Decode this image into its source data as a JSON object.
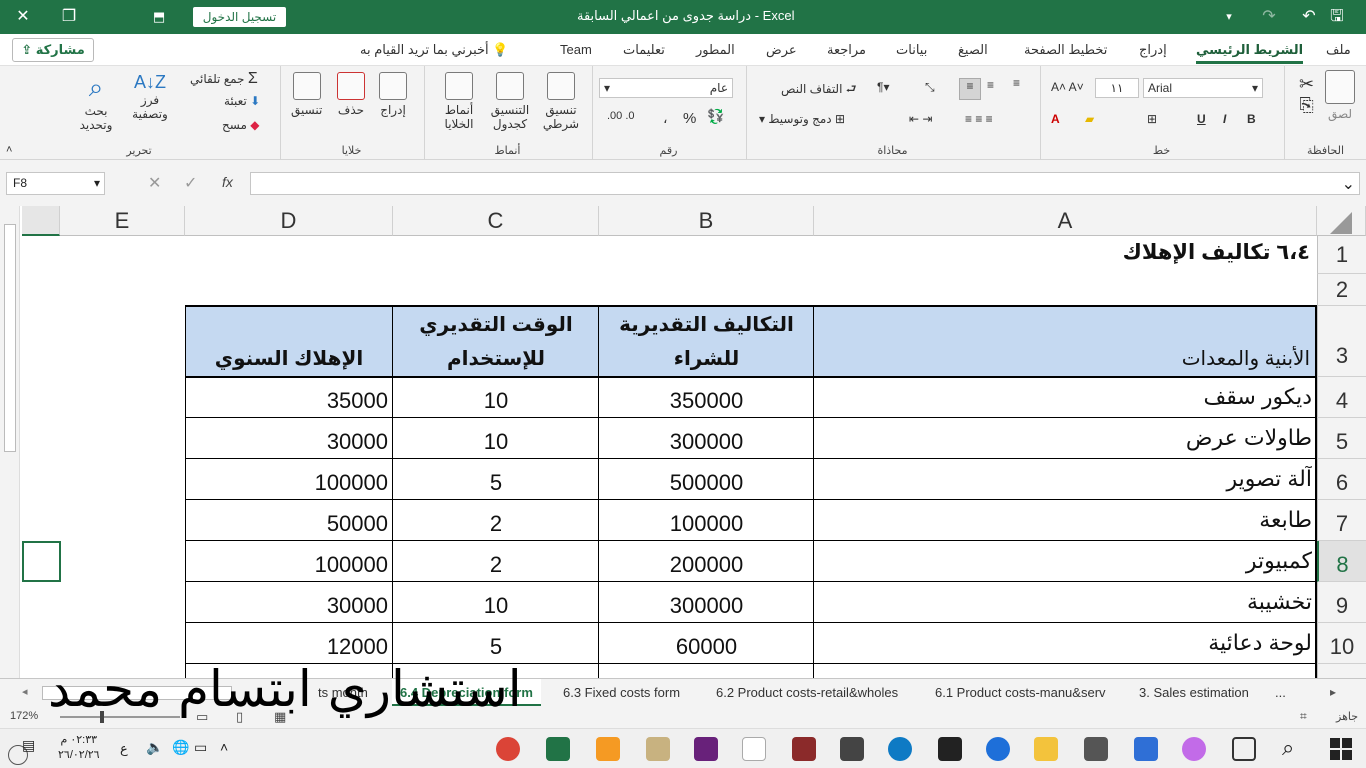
{
  "window": {
    "title": "دراسة جدوى من اعمالي السابقة  -  Excel",
    "sign_in": "تسجيل الدخول"
  },
  "ribbon_tabs": [
    "ملف",
    "الشريط الرئيسي",
    "إدراج",
    "تخطيط الصفحة",
    "الصيغ",
    "بيانات",
    "مراجعة",
    "عرض",
    "المطور",
    "تعليمات",
    "Team"
  ],
  "active_tab": "الشريط الرئيسي",
  "tell_me": "أخبرني بما تريد القيام به",
  "share": "مشاركة",
  "ribbon": {
    "clipboard": {
      "label": "الحافظة",
      "paste": "لصق"
    },
    "font": {
      "label": "خط",
      "name": "Arial",
      "size": "١١",
      "bold": "B",
      "italic": "I",
      "underline": "U"
    },
    "alignment": {
      "label": "محاذاة",
      "wrap": "التفاف النص",
      "merge": "دمج وتوسيط"
    },
    "number": {
      "label": "رقم",
      "format": "عام",
      "percent": "%",
      "comma": "،"
    },
    "styles": {
      "label": "أنماط",
      "conditional": "تنسيق شرطي",
      "as_table": "التنسيق كجدول",
      "cell_styles": "أنماط الخلايا"
    },
    "cells": {
      "label": "خلايا",
      "insert": "إدراج",
      "delete": "حذف",
      "format": "تنسيق"
    },
    "editing": {
      "label": "تحرير",
      "autosum": "جمع تلقائي",
      "fill": "تعبئة",
      "clear": "مسح",
      "sort": "فرز وتصفية",
      "find": "بحث وتحديد"
    }
  },
  "formula_bar": {
    "name_box": "F8",
    "fx": "fx",
    "formula": ""
  },
  "columns": [
    "A",
    "B",
    "C",
    "D",
    "E"
  ],
  "rows": [
    "1",
    "2",
    "3",
    "4",
    "5",
    "6",
    "7",
    "8",
    "9",
    "10"
  ],
  "sheet": {
    "title": "٦،٤  تكاليف الإهلاك",
    "headers": {
      "a": "الأبنية والمعدات",
      "b1": "التكاليف التقديرية",
      "b2": "للشراء",
      "c1": "الوقت التقديري",
      "c2": "للإستخدام",
      "d": "الإهلاك السنوي"
    },
    "data": [
      {
        "a": "ديكور سقف",
        "b": "350000",
        "c": "10",
        "d": "35000"
      },
      {
        "a": "طاولات عرض",
        "b": "300000",
        "c": "10",
        "d": "30000"
      },
      {
        "a": "آلة تصوير",
        "b": "500000",
        "c": "5",
        "d": "100000"
      },
      {
        "a": "طابعة",
        "b": "100000",
        "c": "2",
        "d": "50000"
      },
      {
        "a": "كمبيوتر",
        "b": "200000",
        "c": "2",
        "d": "100000"
      },
      {
        "a": "تخشيبة",
        "b": "300000",
        "c": "10",
        "d": "30000"
      },
      {
        "a": "لوحة دعائية",
        "b": "60000",
        "c": "5",
        "d": "12000"
      }
    ]
  },
  "sheet_tabs": [
    "3. Sales estimation",
    "6.1 Product costs-manu&serv",
    "6.2 Product costs-retail&wholes",
    "6.3 Fixed costs form",
    "6.4 Depreciation form",
    "ts month",
    "..."
  ],
  "active_sheet": "6.4 Depreciation form",
  "status": {
    "ready": "جاهز",
    "zoom": "172%"
  },
  "taskbar": {
    "time": "٠٢:٣٣ م",
    "date": "٢٦/٠٢/٢٦",
    "lang": "ع"
  },
  "overlay_text": "استشاري ابتسام محمد",
  "colors": {
    "excel_green": "#217346",
    "header_fill": "#c5d9f1"
  }
}
